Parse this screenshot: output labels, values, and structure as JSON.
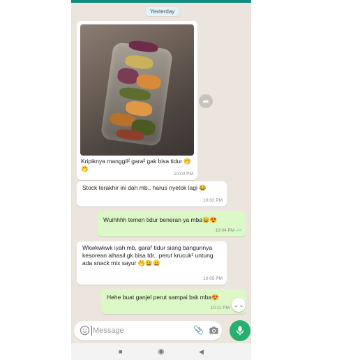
{
  "chat": {
    "date_label": "Yesterday",
    "messages": [
      {
        "type": "image_in",
        "caption": "Kripiknya manggil² gara² gak bisa tidur 🤭🤭",
        "time": "10:02 PM"
      },
      {
        "type": "in",
        "text": "Stock terakhir ini dah mb.. harus nyetok lagi 😂",
        "time": "10:02 PM"
      },
      {
        "type": "out",
        "text": "Wuihhhh temen tidur beneran ya mba😀😍",
        "time": "10:04 PM"
      },
      {
        "type": "in",
        "text": "Wkwkwkwk iyah mb, gara² tidur siang bangunnya kesorean alhasil gk bisa tdr.. perut krucuk² untung ada snack mix sayur 🤭😀😀",
        "time": "10:05 PM"
      },
      {
        "type": "out",
        "text": "Hehe buat ganjel perut sampai bsk mba😍",
        "time": "10:11 PM"
      }
    ]
  },
  "composer": {
    "placeholder": "Message"
  },
  "colors": {
    "incoming": "#ffffff",
    "outgoing": "#dcf8c6",
    "wallpaper": "#ece5dd",
    "accent": "#25b06f",
    "read_ticks": "#34b7f1"
  },
  "icons": [
    "share-icon",
    "emoji-icon",
    "attach-icon",
    "camera-icon",
    "mic-icon",
    "scroll-down-icon",
    "nav-stop-icon",
    "nav-home-icon",
    "nav-back-icon"
  ]
}
